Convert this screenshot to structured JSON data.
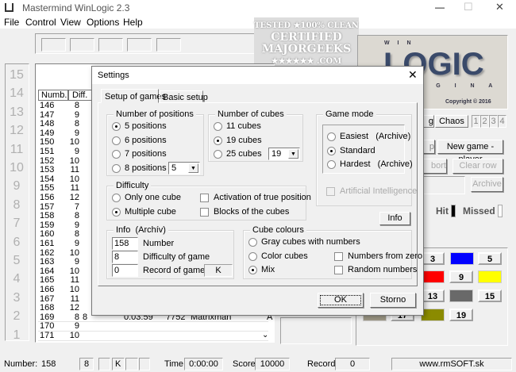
{
  "window": {
    "title": "Mastermind WinLogic 2.3",
    "minimize": "—",
    "maximize": "☐",
    "close": "✕"
  },
  "menu": [
    "File",
    "Control",
    "View",
    "Options",
    "Help"
  ],
  "watermark": {
    "line1": "TESTED ★100% CLEAN",
    "line2": "CERTIFIED",
    "line3": "MAJORGEEKS",
    "line4": "★★★★★★ .COM"
  },
  "logo": {
    "top": "W I N",
    "main": "LOGIC",
    "bottom": "O R I G I N A L",
    "copyright": "Copyright © 2016"
  },
  "row_numbers": [
    "15",
    "14",
    "13",
    "12",
    "11",
    "10",
    "9",
    "8",
    "7",
    "6",
    "5",
    "4",
    "3",
    "2",
    "1"
  ],
  "table": {
    "headers": [
      "Numb.",
      "Diff."
    ],
    "rows": [
      [
        "146",
        "8"
      ],
      [
        "147",
        "9"
      ],
      [
        "148",
        "8"
      ],
      [
        "149",
        "9"
      ],
      [
        "150",
        "10"
      ],
      [
        "151",
        "9"
      ],
      [
        "152",
        "10"
      ],
      [
        "153",
        "11"
      ],
      [
        "154",
        "10"
      ],
      [
        "155",
        "11"
      ],
      [
        "156",
        "12"
      ],
      [
        "157",
        "7"
      ],
      [
        "158",
        "8"
      ],
      [
        "159",
        "9"
      ],
      [
        "160",
        "8"
      ],
      [
        "161",
        "9"
      ],
      [
        "162",
        "10"
      ],
      [
        "163",
        "9"
      ],
      [
        "164",
        "10"
      ],
      [
        "165",
        "11"
      ],
      [
        "166",
        "10"
      ],
      [
        "167",
        "11"
      ],
      [
        "168",
        "12"
      ],
      [
        "169",
        "8",
        "8",
        "0:03:59",
        "7752",
        "Matrixman",
        "A"
      ],
      [
        "170",
        "9"
      ],
      [
        "171",
        "10"
      ]
    ]
  },
  "right_panel": {
    "btn_partial1": "g",
    "chaos": "Chaos",
    "levels": [
      "1",
      "2",
      "3",
      "4"
    ],
    "btn_partial2": "p",
    "new_game_player": "New game - player",
    "btn_partial3": "bort",
    "clear_row": "Clear row",
    "archive": "Archive",
    "hit": "Hit",
    "missed": "Missed"
  },
  "cubes": [
    {
      "label": "3"
    },
    {
      "color": "#0000ff"
    },
    {
      "label": "5"
    },
    {
      "color": "#ff0000"
    },
    {
      "label": "9"
    },
    {
      "color": "#ffff00"
    },
    {
      "label": "13"
    },
    {
      "color": "#696969"
    },
    {
      "label": "15"
    },
    {
      "color": "#a09a88"
    },
    {
      "label": "17"
    },
    {
      "color": "#8b8b00"
    },
    {
      "label": "19"
    }
  ],
  "dialog": {
    "title": "Settings",
    "close": "✕",
    "tabs": [
      "Setup of games",
      "Basic setup"
    ],
    "positions": {
      "label": "Number of positions",
      "options": [
        "5 positions",
        "6 positions",
        "7 positions",
        "8 positions"
      ],
      "selected": 0,
      "select_value": "5"
    },
    "cubes": {
      "label": "Number of cubes",
      "options": [
        "11 cubes",
        "19 cubes",
        "25 cubes"
      ],
      "selected": 1,
      "select_value": "19"
    },
    "game_mode": {
      "label": "Game mode",
      "options": [
        "Easiest   (Archive)",
        "Standard",
        "Hardest   (Archive)"
      ],
      "selected": 1,
      "ai": "Artificial Intelligence"
    },
    "difficulty": {
      "label": "Difficulty",
      "options": [
        "Only one cube",
        "Multiple cube"
      ],
      "selected": 1,
      "checks": [
        "Activation of true position",
        "Blocks of the cubes"
      ]
    },
    "info_button": "Info",
    "info": {
      "label": "Info  (Archív)",
      "number": "158",
      "number_label": "Number",
      "difficulty": "8",
      "difficulty_label": "Difficulty of game",
      "record": "0",
      "record_label": "Record of game",
      "k": "K"
    },
    "colours": {
      "label": "Cube colours",
      "options": [
        "Gray cubes with numbers",
        "Color cubes",
        "Mix"
      ],
      "selected": 2,
      "checks": [
        "Numbers from zero",
        "Random numbers"
      ]
    },
    "ok": "OK",
    "storno": "Storno"
  },
  "status": {
    "number_label": "Number:",
    "number": "158",
    "diff": "8",
    "k": "K",
    "time_label": "Time",
    "time": "0:00:00",
    "score_label": "Score",
    "score": "10000",
    "record_label": "Record",
    "record": "0",
    "website": "www.rmSOFT.sk"
  }
}
